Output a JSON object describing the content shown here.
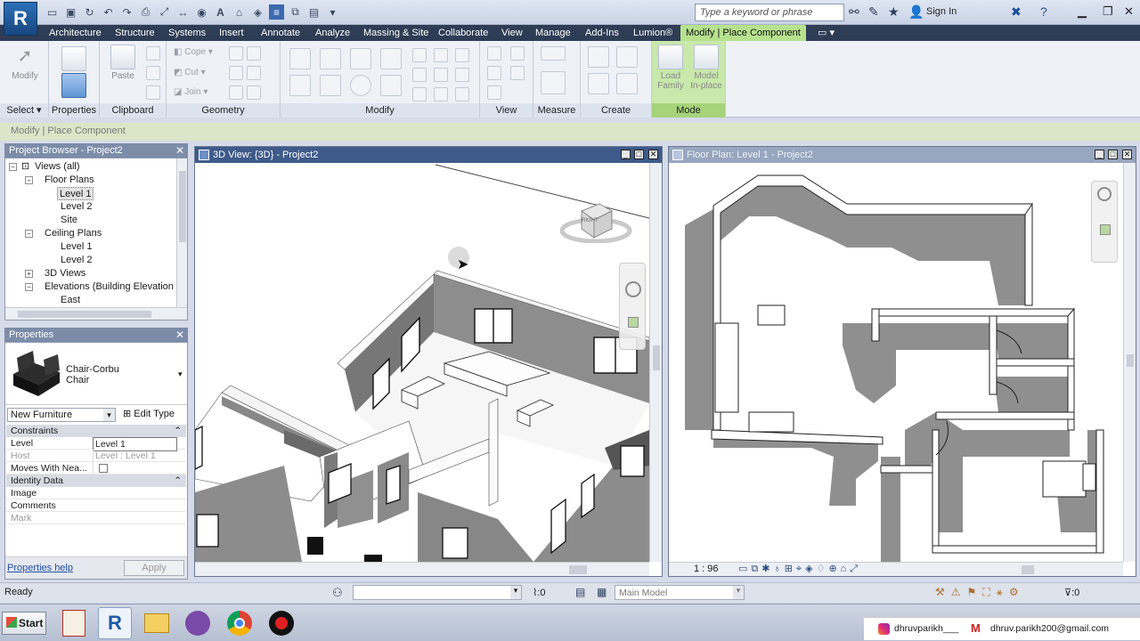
{
  "app": {
    "logo_letter": "R",
    "search_placeholder": "Type a keyword or phrase",
    "sign_in": "Sign In"
  },
  "ribbon_tabs": [
    "Architecture",
    "Structure",
    "Systems",
    "Insert",
    "Annotate",
    "Analyze",
    "Massing & Site",
    "Collaborate",
    "View",
    "Manage",
    "Add-Ins",
    "Lumion®",
    "Modify | Place Component"
  ],
  "ribbon": {
    "select_label": "Select",
    "modify_label": "Modify",
    "properties_label": "Properties",
    "paste_label": "Paste",
    "cope_label": "Cope",
    "cut_label": "Cut",
    "join_label": "Join",
    "load_family_label": "Load Family",
    "model_inplace_label": "Model In-place",
    "panels": [
      "Properties",
      "Clipboard",
      "Geometry",
      "Modify",
      "View",
      "Measure",
      "Create",
      "Mode"
    ]
  },
  "options_bar": {
    "context": "Modify | Place Component"
  },
  "project_browser": {
    "title": "Project Browser - Project2",
    "items": [
      {
        "label": "Views (all)",
        "toggle": "−"
      },
      {
        "label": "Floor Plans",
        "toggle": "−"
      },
      {
        "label": "Level 1",
        "toggle": ""
      },
      {
        "label": "Level 2",
        "toggle": ""
      },
      {
        "label": "Site",
        "toggle": ""
      },
      {
        "label": "Ceiling Plans",
        "toggle": "−"
      },
      {
        "label": "Level 1",
        "toggle": ""
      },
      {
        "label": "Level 2",
        "toggle": ""
      },
      {
        "label": "3D Views",
        "toggle": "+"
      },
      {
        "label": "Elevations (Building Elevation",
        "toggle": "−"
      },
      {
        "label": "East",
        "toggle": ""
      }
    ]
  },
  "properties": {
    "title": "Properties",
    "type_name_1": "Chair-Corbu",
    "type_name_2": "Chair",
    "category_select": "New Furniture",
    "edit_type": "Edit Type",
    "groups": [
      "Constraints",
      "Identity Data"
    ],
    "rows": [
      {
        "key": "Level",
        "value": "Level 1"
      },
      {
        "key": "Host",
        "value": "Level : Level 1"
      },
      {
        "key": "Moves With Nea...",
        "value": ""
      },
      {
        "key": "Image",
        "value": ""
      },
      {
        "key": "Comments",
        "value": ""
      },
      {
        "key": "Mark",
        "value": ""
      }
    ],
    "help_link": "Properties help",
    "apply": "Apply"
  },
  "view_3d": {
    "title": "3D View: {3D} - Project2",
    "viewcube_face": "RIGHT"
  },
  "view_plan": {
    "title": "Floor Plan: Level 1 - Project2",
    "scale": "1 : 96"
  },
  "status": {
    "text": "Ready",
    "worksets_count": ":0",
    "design_options": "Main Model",
    "filter_count": ":0"
  },
  "taskbar": {
    "start": "Start",
    "instagram": "dhruvparikh___",
    "email": "dhruv.parikh200@gmail.com"
  },
  "colors": {
    "active_tab": "#b6e28f",
    "title_active": "#3f5b8b",
    "wall_fill": "#8f8f8f",
    "tab_bar": "#2f3c55"
  }
}
